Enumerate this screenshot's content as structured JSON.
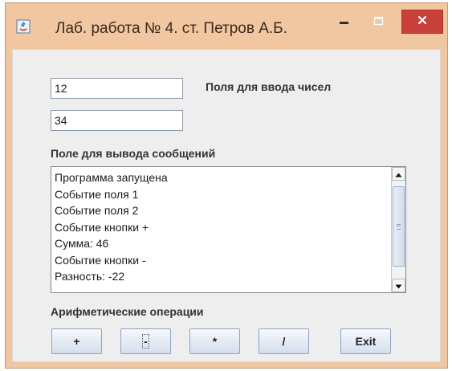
{
  "window": {
    "title": "Лаб. работа № 4. ст. Петров А.Б.",
    "icon": "java-app-icon",
    "controls": {
      "minimize": "minimize-icon",
      "maximize": "maximize-icon",
      "close": "close-icon"
    },
    "colors": {
      "titlebar": "#f0c7a0",
      "close_button": "#c9403a"
    }
  },
  "inputs": {
    "label": "Поля для ввода чисел",
    "first_value": "12",
    "second_value": "34"
  },
  "messages": {
    "label": "Поле для вывода сообщений",
    "lines": [
      "Программа запущена",
      "Событие поля 1",
      "Событие поля 2",
      "Событие кнопки +",
      "Сумма: 46",
      "Событие кнопки -",
      "Разность: -22"
    ]
  },
  "operations": {
    "label": "Арифметические операции",
    "plus": "+",
    "minus": "-",
    "multiply": "*",
    "divide": "/",
    "exit": "Exit"
  }
}
